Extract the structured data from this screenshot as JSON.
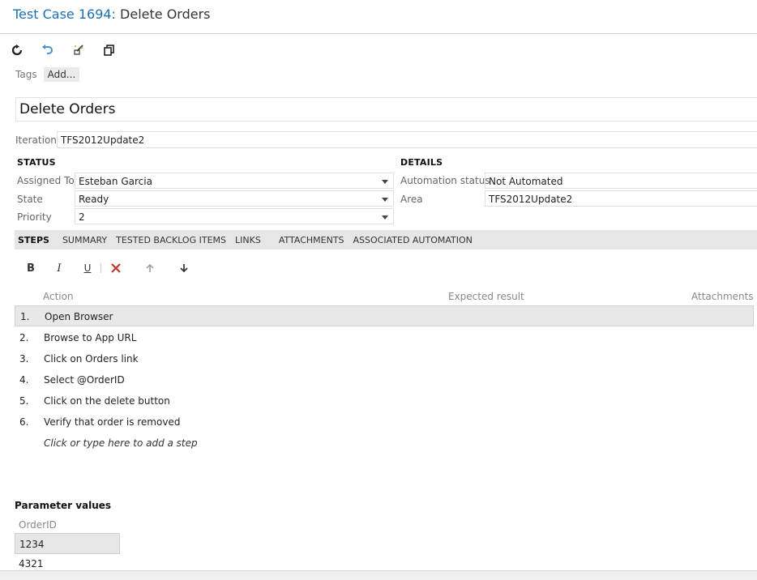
{
  "title": {
    "id": "Test Case 1694:",
    "name": "Delete Orders"
  },
  "toolbar": {
    "buttons": [
      {
        "name": "refresh-icon"
      },
      {
        "name": "undo-icon"
      },
      {
        "name": "edit-clear-icon"
      },
      {
        "name": "copy-icon"
      }
    ]
  },
  "tags": {
    "label": "Tags",
    "add": "Add..."
  },
  "work_item_title": "Delete Orders",
  "iteration": {
    "label": "Iteration",
    "value": "TFS2012Update2"
  },
  "status": {
    "header": "STATUS",
    "assigned_to": {
      "label": "Assigned To",
      "value": "Esteban Garcia"
    },
    "state": {
      "label": "State",
      "value": "Ready"
    },
    "priority": {
      "label": "Priority",
      "value": "2"
    }
  },
  "details": {
    "header": "DETAILS",
    "automation_status": {
      "label": "Automation status",
      "value": "Not Automated"
    },
    "area": {
      "label": "Area",
      "value": "TFS2012Update2"
    }
  },
  "tabs": [
    "STEPS",
    "SUMMARY",
    "TESTED BACKLOG ITEMS",
    "LINKS",
    "ATTACHMENTS",
    "ASSOCIATED AUTOMATION"
  ],
  "rich_text": {
    "bold": "B",
    "italic": "I",
    "underline": "U"
  },
  "steps_grid": {
    "columns": {
      "action": "Action",
      "expected": "Expected result",
      "attachments": "Attachments"
    },
    "rows": [
      {
        "num": "1.",
        "action": "Open Browser"
      },
      {
        "num": "2.",
        "action": "Browse to App URL"
      },
      {
        "num": "3.",
        "action": "Click on Orders link"
      },
      {
        "num": "4.",
        "action": "Select @OrderID"
      },
      {
        "num": "5.",
        "action": "Click on the delete button"
      },
      {
        "num": "6.",
        "action": "Verify that order is removed"
      }
    ],
    "add_placeholder": "Click or type here to add a step"
  },
  "parameters": {
    "header": "Parameter values",
    "column": "OrderID",
    "values": [
      "1234",
      "4321"
    ]
  },
  "colors": {
    "title_link": "#1b6fb5",
    "delete": "#c0392b",
    "tab_bg": "#e6e6e6"
  }
}
